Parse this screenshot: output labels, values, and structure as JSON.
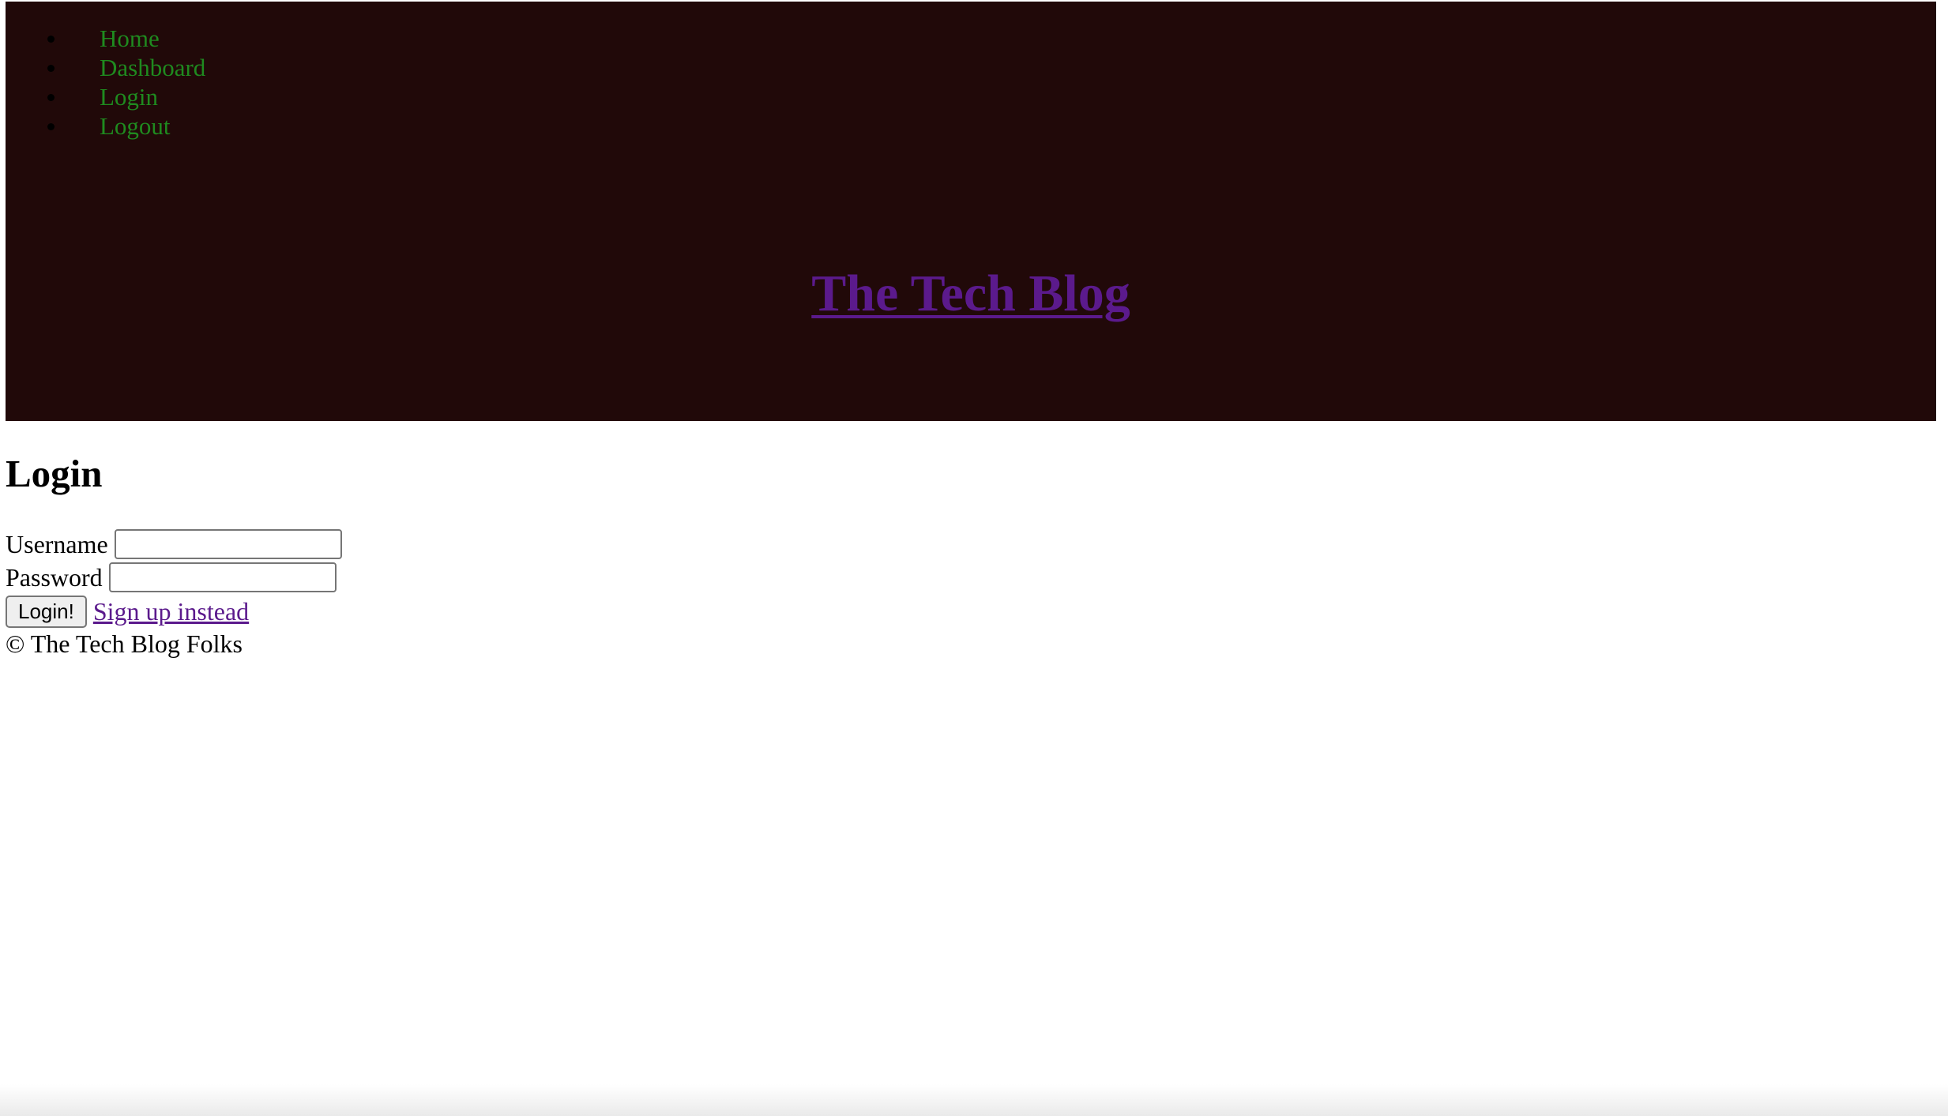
{
  "nav": {
    "items": [
      {
        "label": "Home"
      },
      {
        "label": "Dashboard"
      },
      {
        "label": "Login"
      },
      {
        "label": "Logout"
      }
    ]
  },
  "header": {
    "title": "The Tech Blog"
  },
  "login": {
    "heading": "Login",
    "username_label": "Username",
    "username_value": "",
    "password_label": "Password",
    "password_value": "",
    "submit_label": "Login!",
    "signup_link": "Sign up instead"
  },
  "footer": {
    "text": "© The Tech Blog Folks"
  },
  "colors": {
    "header_bg": "#210909",
    "nav_link": "#1f8a1f",
    "visited_link": "#5b1a8c"
  }
}
